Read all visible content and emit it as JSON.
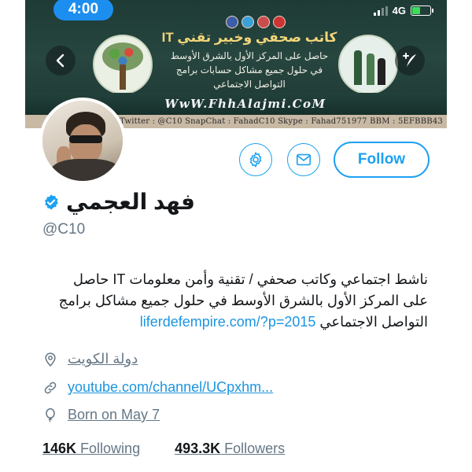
{
  "status_bar": {
    "time": "4:00",
    "network": "4G"
  },
  "banner": {
    "title": "كاتب صحفي وخبير تقني IT",
    "subtitle_lines": [
      "حاصل على المركز الأول بالشرق الأوسط",
      "في حلول جميع مشاكل حسابات برامج",
      "التواصل الاجتماعي"
    ],
    "website": "WwW.FhhAlajmi.CoM",
    "contact_line": "Twitter : @C10   SnapChat : FahadC10   Skype : Fahad751977   BBM : 5EFBBB43"
  },
  "profile": {
    "name": "فهد العجمي",
    "handle": "@C10",
    "bio_line1": "ناشط اجتماعي وكاتب صحفي / تقنية وأمن معلومات IT حاصل",
    "bio_line2": "على المركز الأول بالشرق الأوسط في حلول جميع مشاكل برامج",
    "bio_line3_text": "التواصل الاجتماعي",
    "bio_link": "liferdefempire.com/?p=2015",
    "location": "دولة الكويت",
    "website": "youtube.com/channel/UCpxhm...",
    "birthday": "Born on May 7",
    "following_count": "146K",
    "following_label": "Following",
    "followers_count": "493.3K",
    "followers_label": "Followers"
  },
  "actions": {
    "follow_label": "Follow"
  },
  "icons": {
    "back": "chevron-left-icon",
    "compose": "compose-icon",
    "settings": "gear-icon",
    "message": "envelope-icon",
    "verified": "verified-badge-icon",
    "location": "location-pin-icon",
    "link": "link-icon",
    "birthday": "balloon-icon"
  },
  "colors": {
    "accent": "#1da1f2",
    "link": "#1b95e0",
    "secondary_text": "#657786",
    "primary_text": "#14171a"
  }
}
